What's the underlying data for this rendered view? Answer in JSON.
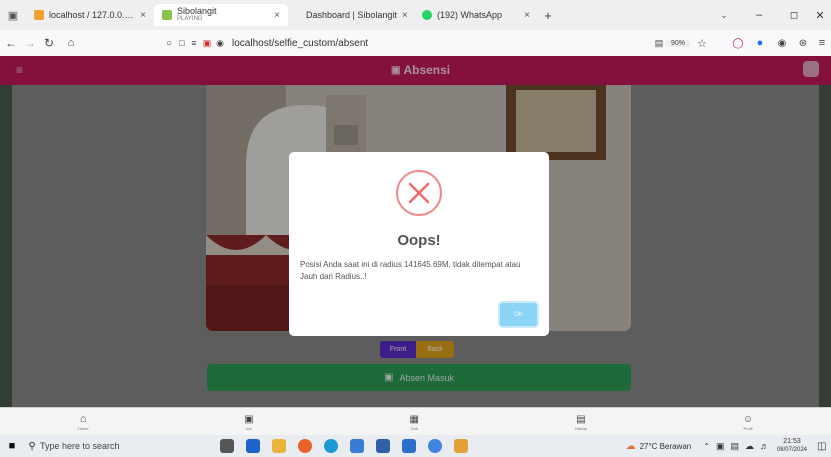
{
  "browser": {
    "tabs": [
      {
        "label": "localhost / 127.0.0.1 | phpMyAdmin"
      },
      {
        "label": "Sibolangit",
        "sublabel": "PLAYING"
      },
      {
        "label": "Dashboard | Sibolangit"
      },
      {
        "label": "(192) WhatsApp"
      }
    ],
    "url": "localhost/selfie_custom/absent",
    "zoom": "90%"
  },
  "app": {
    "title": "Absensi",
    "front_label": "Front",
    "back_label": "Back",
    "absen_label": "Absen Masuk"
  },
  "modal": {
    "title": "Oops!",
    "message": "Posisi Anda saat ini di radius 141645.69M, tidak ditempat atau Jauh dari Radius..!",
    "ok_label": "OK"
  },
  "bottom_nav": [
    {
      "label": "Home"
    },
    {
      "label": "Izin"
    },
    {
      "label": "Cuti"
    },
    {
      "label": "History"
    },
    {
      "label": "Profil"
    }
  ],
  "taskbar": {
    "search_placeholder": "Type here to search",
    "weather": "27°C Berawan",
    "time": "21:53",
    "date": "08/07/2024"
  }
}
